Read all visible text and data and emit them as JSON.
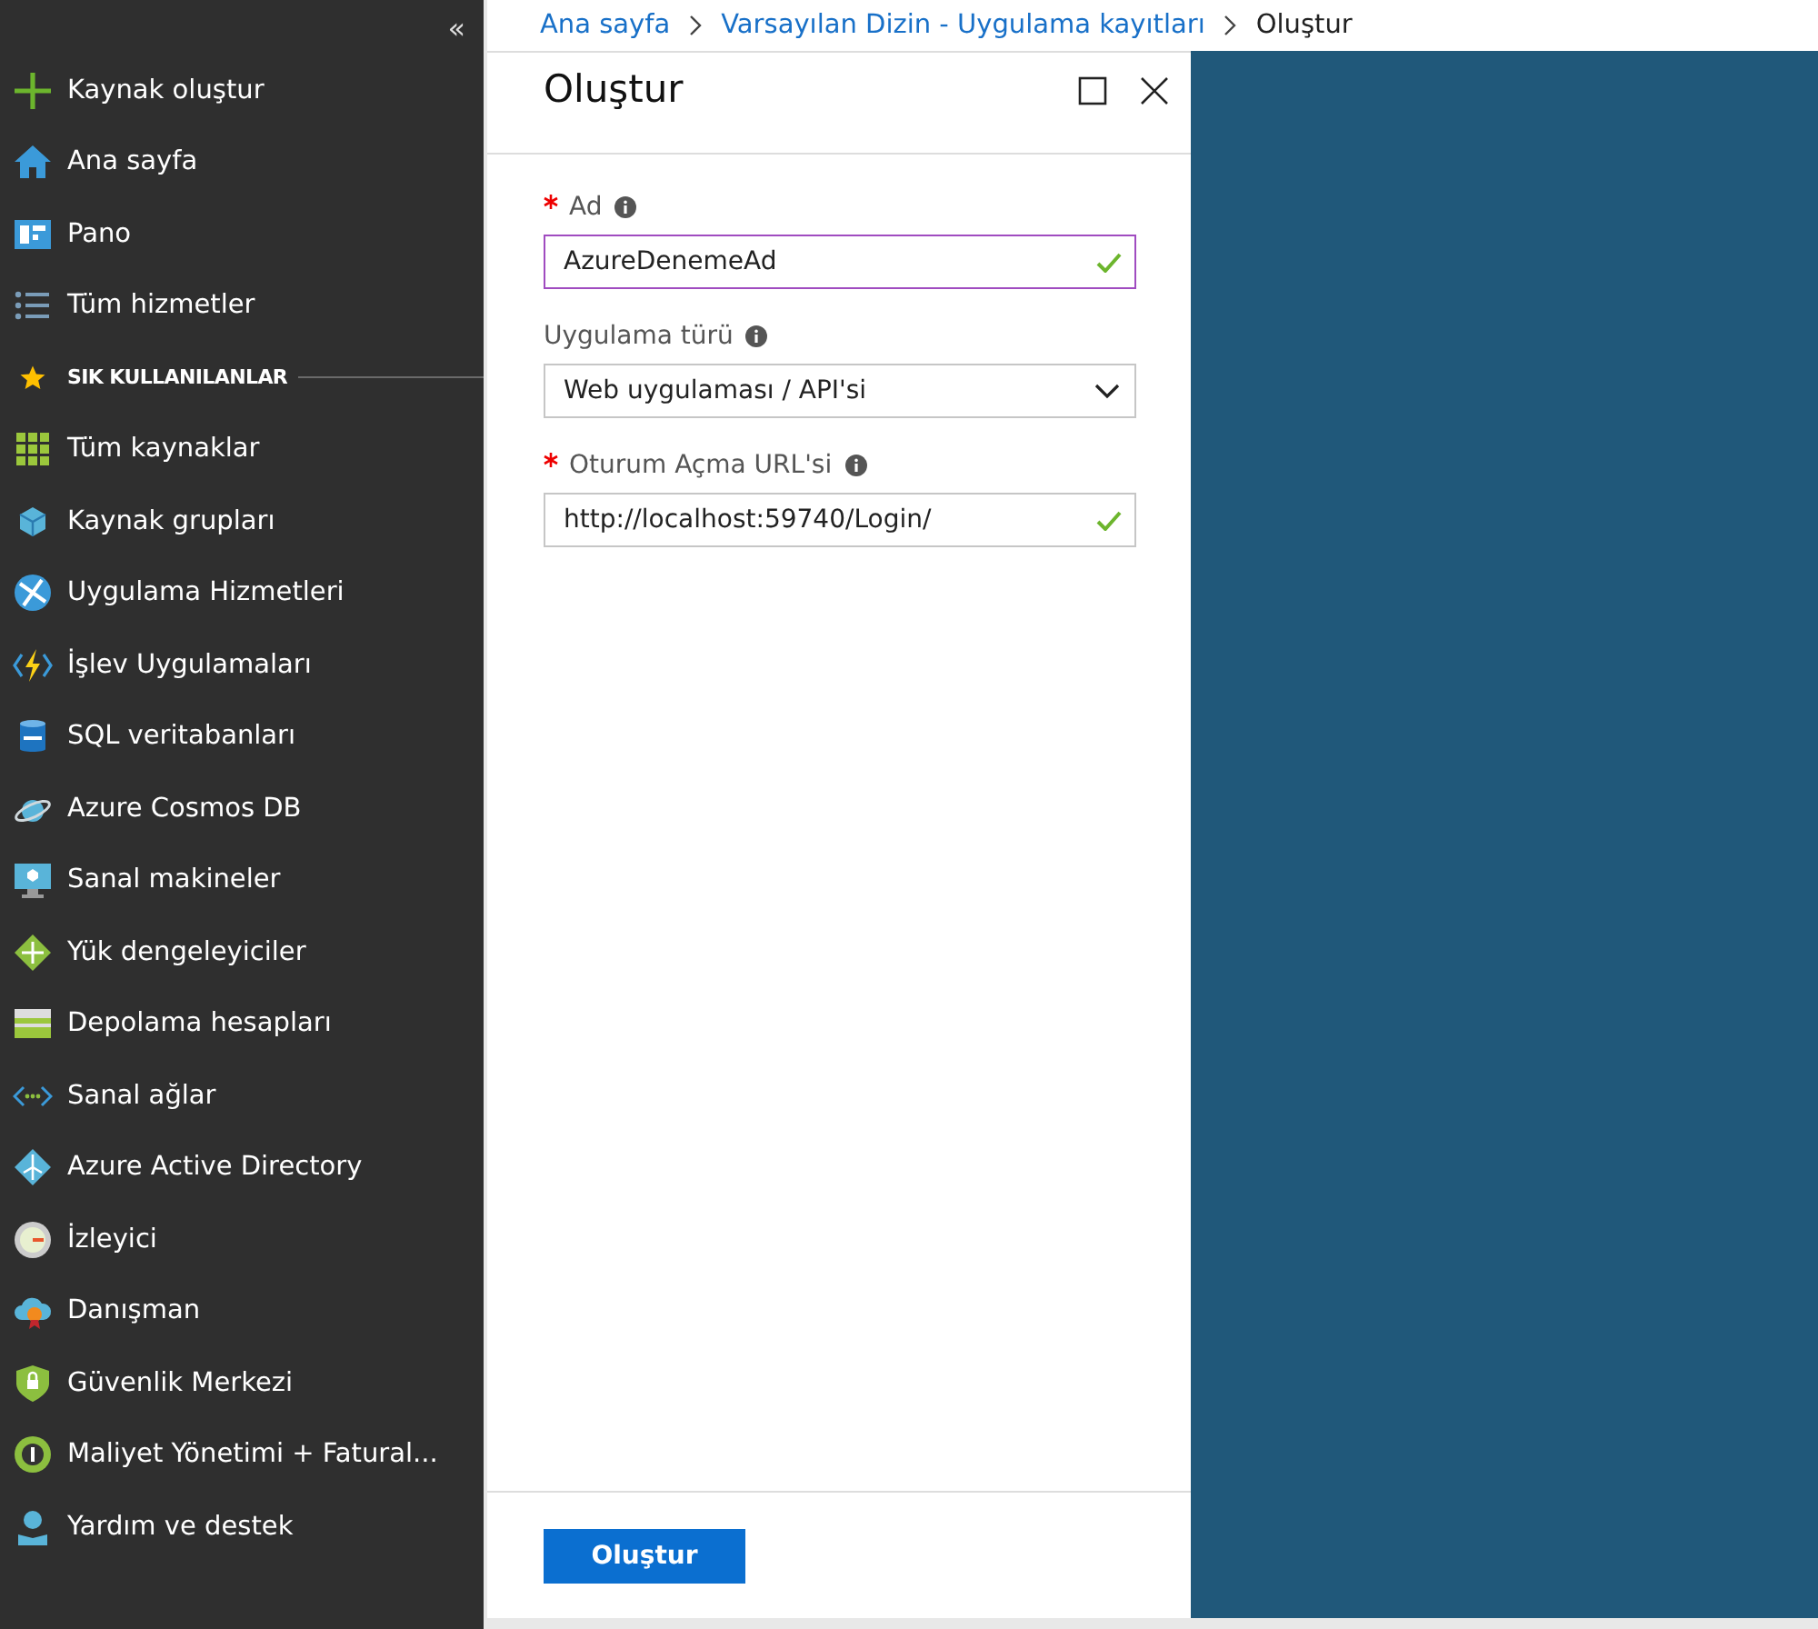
{
  "sidebar": {
    "collapse": "«",
    "items": [
      {
        "kind": "item",
        "label": "Kaynak oluştur"
      },
      {
        "kind": "item",
        "label": "Ana sayfa"
      },
      {
        "kind": "item",
        "label": "Pano"
      },
      {
        "kind": "item",
        "label": "Tüm hizmetler"
      },
      {
        "kind": "section",
        "label": "SIK KULLANILANLAR"
      },
      {
        "kind": "item",
        "label": "Tüm kaynaklar"
      },
      {
        "kind": "item",
        "label": "Kaynak grupları"
      },
      {
        "kind": "item",
        "label": "Uygulama Hizmetleri"
      },
      {
        "kind": "item",
        "label": "İşlev Uygulamaları"
      },
      {
        "kind": "item",
        "label": "SQL veritabanları"
      },
      {
        "kind": "item",
        "label": "Azure Cosmos DB"
      },
      {
        "kind": "item",
        "label": "Sanal makineler"
      },
      {
        "kind": "item",
        "label": "Yük dengeleyiciler"
      },
      {
        "kind": "item",
        "label": "Depolama hesapları"
      },
      {
        "kind": "item",
        "label": "Sanal ağlar"
      },
      {
        "kind": "item",
        "label": "Azure Active Directory"
      },
      {
        "kind": "item",
        "label": "İzleyici"
      },
      {
        "kind": "item",
        "label": "Danışman"
      },
      {
        "kind": "item",
        "label": "Güvenlik Merkezi"
      },
      {
        "kind": "item",
        "label": "Maliyet Yönetimi + Fatural..."
      },
      {
        "kind": "item",
        "label": "Yardım ve destek"
      }
    ]
  },
  "breadcrumb": [
    {
      "label": "Ana sayfa",
      "link": true
    },
    {
      "label": "Varsayılan Dizin - Uygulama kayıtları",
      "link": true
    },
    {
      "label": "Oluştur",
      "link": false
    }
  ],
  "blade": {
    "title": "Oluştur",
    "fields": [
      {
        "kind": "text",
        "label": "Ad",
        "required": true,
        "value": "AzureDenemeAd",
        "valid": true,
        "focused": true
      },
      {
        "kind": "select",
        "label": "Uygulama türü",
        "required": false,
        "value": "Web uygulaması / API'si",
        "valid": false,
        "focused": false
      },
      {
        "kind": "text",
        "label": "Oturum Açma URL'si",
        "required": true,
        "value": "http://localhost:59740/Login/",
        "valid": true,
        "focused": false
      }
    ],
    "submit": "Oluştur"
  }
}
